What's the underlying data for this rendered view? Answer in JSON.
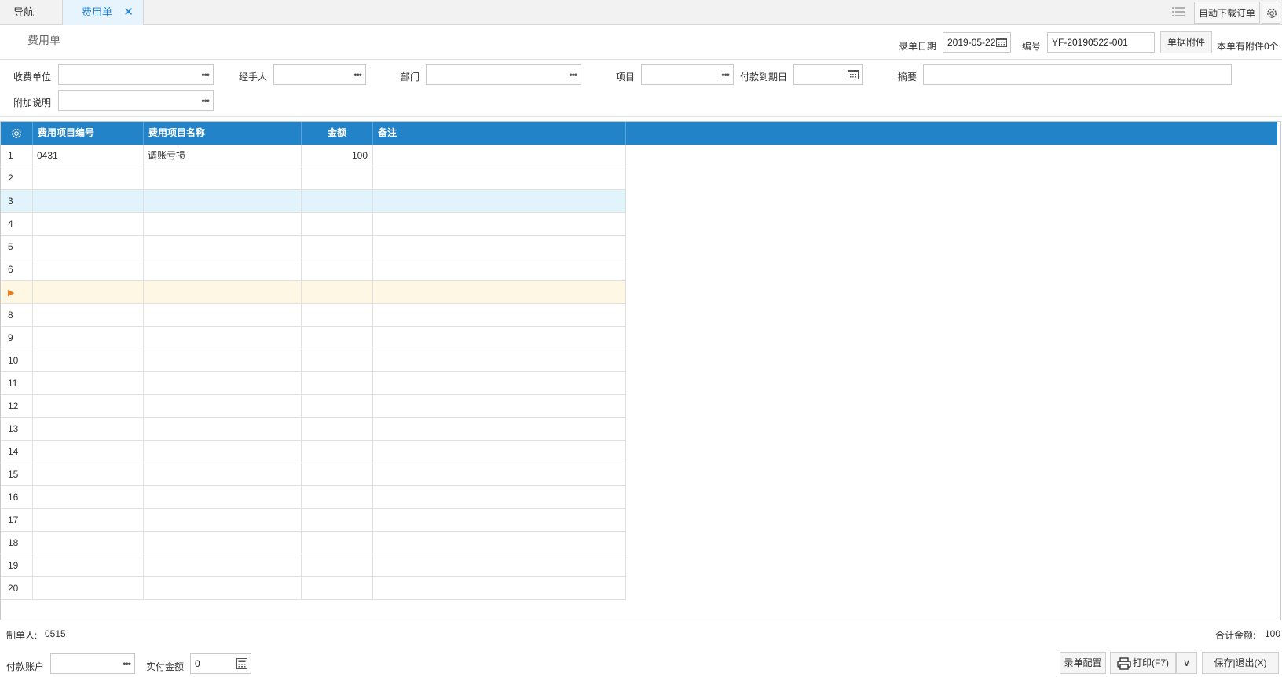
{
  "tabs": {
    "nav_label": "导航",
    "active_label": "费用单",
    "close_glyph": "✕",
    "auto_download_label": "自动下载订单",
    "icons": [
      "list-icon",
      "gear-icon"
    ]
  },
  "header": {
    "page_title": "费用单",
    "date_label": "录单日期",
    "date_value": "2019-05-22",
    "number_label": "编号",
    "number_value": "YF-20190522-001",
    "attach_button": "单据附件",
    "attach_info": "本单有附件0个"
  },
  "filters": {
    "payee_label": "收费单位",
    "payee_value": "",
    "handler_label": "经手人",
    "handler_value": "",
    "dept_label": "部门",
    "dept_value": "",
    "project_label": "项目",
    "project_value": "",
    "due_date_label": "付款到期日",
    "due_date_value": "",
    "summary_label": "摘要",
    "summary_value": "",
    "note_label": "附加说明",
    "note_value": "",
    "lookup_glyph": "•••"
  },
  "grid": {
    "columns": [
      "费用项目编号",
      "费用项目名称",
      "金额",
      "备注"
    ],
    "current_row_marker": "▶",
    "rows": [
      {
        "num": "1",
        "code": "0431",
        "name": "调账亏损",
        "amount": "100",
        "remark": ""
      },
      {
        "num": "2",
        "code": "",
        "name": "",
        "amount": "",
        "remark": ""
      },
      {
        "num": "3",
        "code": "",
        "name": "",
        "amount": "",
        "remark": ""
      },
      {
        "num": "4",
        "code": "",
        "name": "",
        "amount": "",
        "remark": ""
      },
      {
        "num": "5",
        "code": "",
        "name": "",
        "amount": "",
        "remark": ""
      },
      {
        "num": "6",
        "code": "",
        "name": "",
        "amount": "",
        "remark": ""
      },
      {
        "num": "",
        "code": "",
        "name": "",
        "amount": "",
        "remark": ""
      },
      {
        "num": "8",
        "code": "",
        "name": "",
        "amount": "",
        "remark": ""
      },
      {
        "num": "9",
        "code": "",
        "name": "",
        "amount": "",
        "remark": ""
      },
      {
        "num": "10",
        "code": "",
        "name": "",
        "amount": "",
        "remark": ""
      },
      {
        "num": "11",
        "code": "",
        "name": "",
        "amount": "",
        "remark": ""
      },
      {
        "num": "12",
        "code": "",
        "name": "",
        "amount": "",
        "remark": ""
      },
      {
        "num": "13",
        "code": "",
        "name": "",
        "amount": "",
        "remark": ""
      },
      {
        "num": "14",
        "code": "",
        "name": "",
        "amount": "",
        "remark": ""
      },
      {
        "num": "15",
        "code": "",
        "name": "",
        "amount": "",
        "remark": ""
      },
      {
        "num": "16",
        "code": "",
        "name": "",
        "amount": "",
        "remark": ""
      },
      {
        "num": "17",
        "code": "",
        "name": "",
        "amount": "",
        "remark": ""
      },
      {
        "num": "18",
        "code": "",
        "name": "",
        "amount": "",
        "remark": ""
      },
      {
        "num": "19",
        "code": "",
        "name": "",
        "amount": "",
        "remark": ""
      },
      {
        "num": "20",
        "code": "",
        "name": "",
        "amount": "",
        "remark": ""
      }
    ],
    "selected_row_index": 2,
    "current_row_index": 6
  },
  "footer": {
    "maker_label": "制单人:",
    "maker_value": "0515",
    "total_label": "合计金额:",
    "total_value": "100",
    "account_label": "付款账户",
    "account_value": "",
    "paid_label": "实付金额",
    "paid_value": "0",
    "config_button": "录单配置",
    "print_button": "打印(F7)",
    "print_dropdown_glyph": "∨",
    "save_button": "保存|退出(X)"
  },
  "colors": {
    "accent": "#2383c8",
    "tab_active_text": "#1e7fd0",
    "selected_row": "#e1f3fb",
    "current_row": "#fdf7e3"
  }
}
